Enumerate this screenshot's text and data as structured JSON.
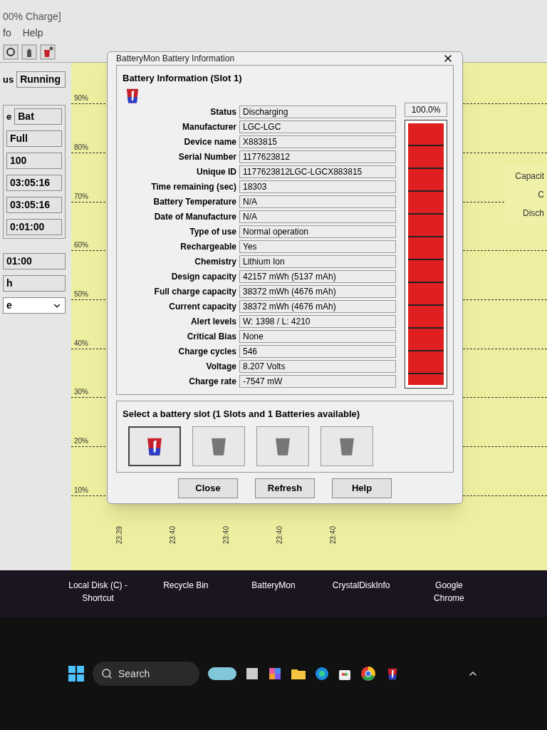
{
  "main_window": {
    "title": "00% Charge]",
    "menu": [
      "fo",
      "Help"
    ],
    "status": {
      "label": "us",
      "value": "Running"
    },
    "fields": [
      {
        "label": "e",
        "value": "Bat"
      },
      {
        "value": "Full"
      },
      {
        "value": "100"
      },
      {
        "value": "03:05:16"
      },
      {
        "value": "03:05:16"
      },
      {
        "value": "0:01:00"
      }
    ],
    "fields_2": [
      {
        "value": "01:00"
      },
      {
        "value": "h"
      }
    ],
    "dropdown": {
      "value": "e"
    },
    "grid_labels": [
      "90%",
      "80%",
      "70%",
      "60%",
      "50%",
      "40%",
      "30%",
      "20%",
      "10%"
    ],
    "time_labels": [
      "23:39",
      "23:40",
      "23:40",
      "23:40",
      "23:40"
    ],
    "legend": [
      "Capacit",
      "C",
      "Disch"
    ]
  },
  "dialog": {
    "title": "BatteryMon Battery Information",
    "group_title": "Battery Information (Slot 1)",
    "rows": [
      {
        "label": "Status",
        "value": "Discharging"
      },
      {
        "label": "Manufacturer",
        "value": "LGC-LGC"
      },
      {
        "label": "Device name",
        "value": "X883815"
      },
      {
        "label": "Serial Number",
        "value": "1177623812"
      },
      {
        "label": "Unique ID",
        "value": "1177623812LGC-LGCX883815"
      },
      {
        "label": "Time remaining (sec)",
        "value": "18303"
      },
      {
        "label": "Battery Temperature",
        "value": "N/A"
      },
      {
        "label": "Date of Manufacture",
        "value": "N/A"
      },
      {
        "label": "Type of use",
        "value": "Normal operation"
      },
      {
        "label": "Rechargeable",
        "value": "Yes"
      },
      {
        "label": "Chemistry",
        "value": "Lithium Ion"
      },
      {
        "label": "Design capacity",
        "value": "42157 mWh (5137 mAh)"
      },
      {
        "label": "Full charge capacity",
        "value": "38372 mWh (4676 mAh)"
      },
      {
        "label": "Current capacity",
        "value": "38372 mWh (4676 mAh)"
      },
      {
        "label": "Alert levels",
        "value": "W: 1398 / L: 4210"
      },
      {
        "label": "Critical Bias",
        "value": "None"
      },
      {
        "label": "Charge cycles",
        "value": "546"
      },
      {
        "label": "Voltage",
        "value": "8.207 Volts"
      },
      {
        "label": "Charge rate",
        "value": "-7547 mW"
      }
    ],
    "meter": {
      "reading": "100.0%",
      "level": 1.0
    },
    "slot_group_title": "Select a battery slot (1 Slots and 1 Batteries available)",
    "slots": [
      {
        "selected": true,
        "available": true
      },
      {
        "selected": false,
        "available": false
      },
      {
        "selected": false,
        "available": false
      },
      {
        "selected": false,
        "available": false
      }
    ],
    "buttons": [
      "Close",
      "Refresh",
      "Help"
    ]
  },
  "desktop_icons": [
    "Local Disk (C) - Shortcut",
    "Recycle Bin",
    "BatteryMon",
    "CrystalDiskInfo",
    "Google Chrome"
  ],
  "taskbar": {
    "search": {
      "placeholder": "Search"
    }
  }
}
